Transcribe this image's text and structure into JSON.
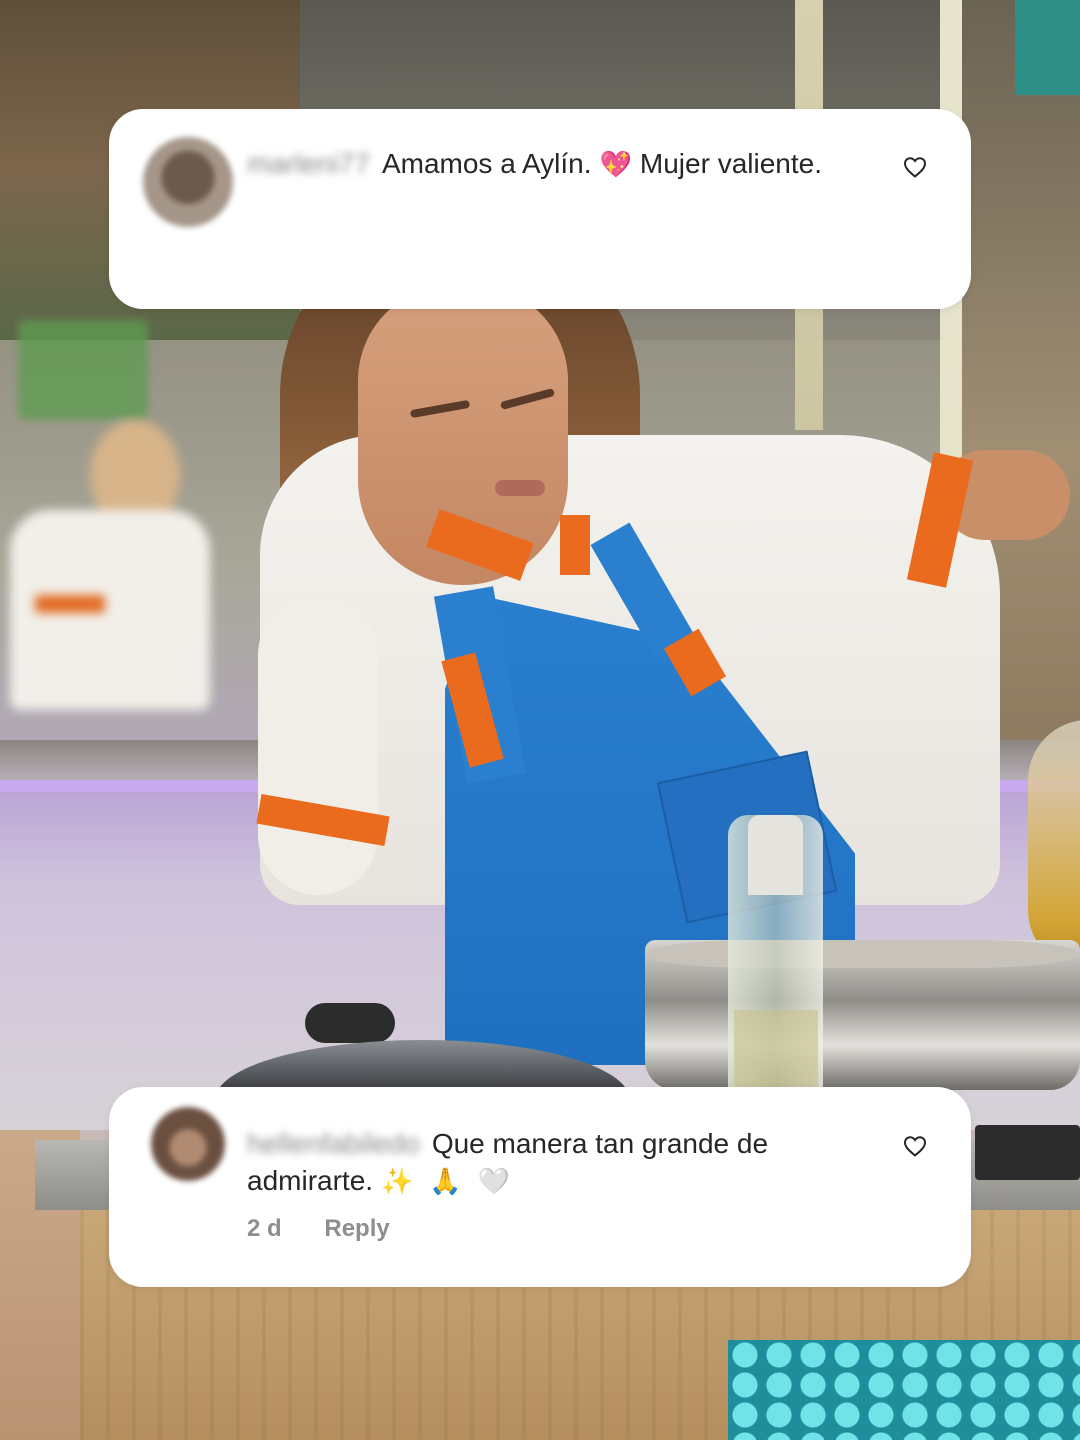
{
  "comments": [
    {
      "username": "marleni77",
      "text_parts": [
        "Amamos a Aylín.",
        "Mujer valiente."
      ],
      "emojis": [
        "💖"
      ],
      "liked": false
    },
    {
      "username": "hellenfabiledo",
      "text": "Que manera tan grande de admirarte.",
      "emojis": [
        "✨",
        "🙏",
        "🤍"
      ],
      "time": "2 d",
      "reply_label": "Reply",
      "liked": false
    }
  ],
  "icons": {
    "like": "heart-outline-icon"
  },
  "colors": {
    "card_bg": "#ffffff",
    "text": "#262626",
    "meta": "#8e8e8e",
    "apron_blue": "#2a7fcf",
    "jacket_orange": "#ea6a1e"
  }
}
